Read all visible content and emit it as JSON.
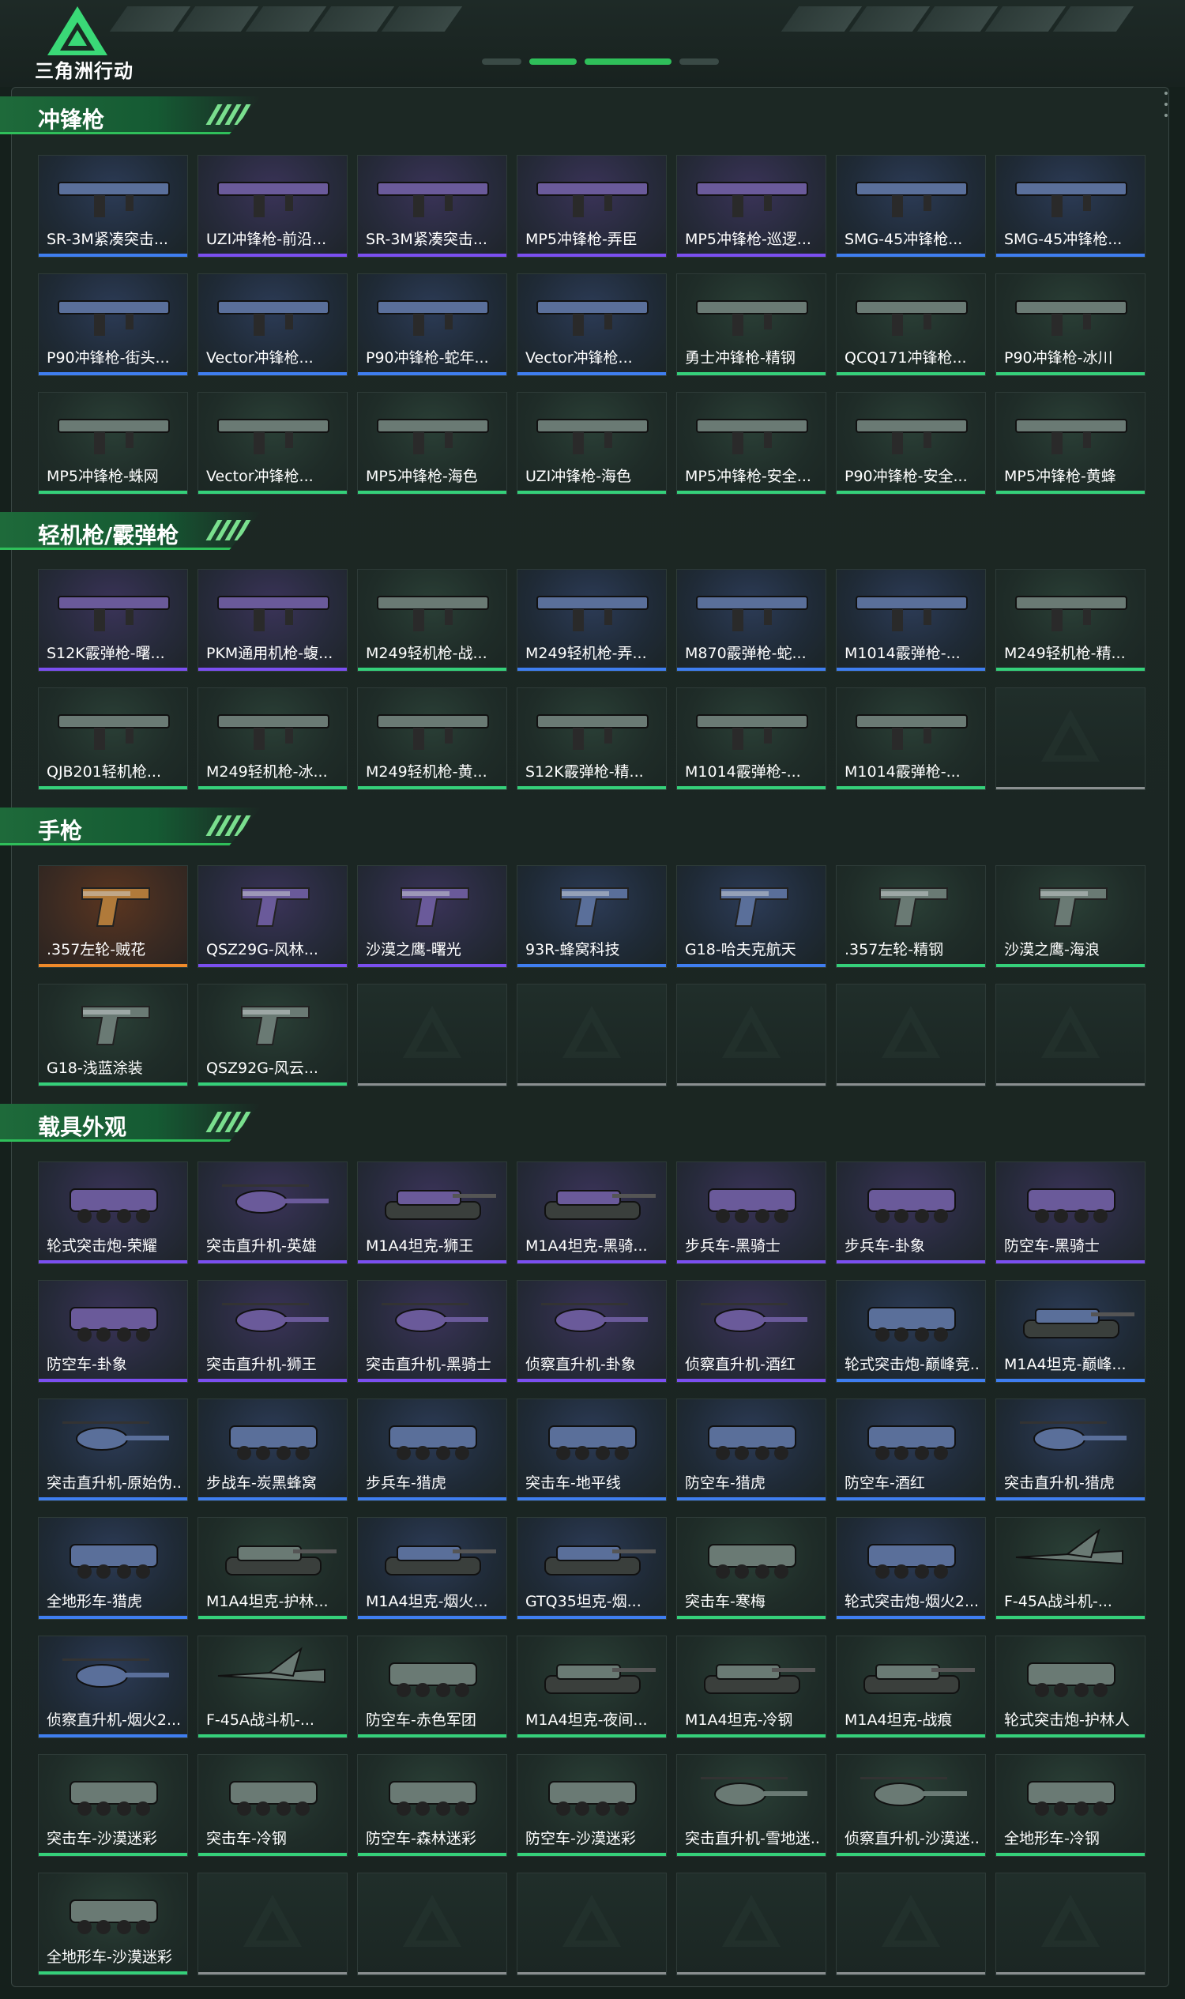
{
  "header": {
    "logo_text": "三角洲行动"
  },
  "sections": [
    {
      "title": "冲锋枪",
      "items": [
        {
          "name": "SR-3M紧凑突击...",
          "rarity": "blue",
          "kind": "gun"
        },
        {
          "name": "UZI冲锋枪-前沿...",
          "rarity": "purple",
          "kind": "gun"
        },
        {
          "name": "SR-3M紧凑突击...",
          "rarity": "purple",
          "kind": "gun"
        },
        {
          "name": "MP5冲锋枪-弄臣",
          "rarity": "purple",
          "kind": "gun"
        },
        {
          "name": "MP5冲锋枪-巡逻...",
          "rarity": "purple",
          "kind": "gun"
        },
        {
          "name": "SMG-45冲锋枪...",
          "rarity": "blue",
          "kind": "gun"
        },
        {
          "name": "SMG-45冲锋枪...",
          "rarity": "blue",
          "kind": "gun"
        },
        {
          "name": "P90冲锋枪-街头...",
          "rarity": "blue",
          "kind": "gun"
        },
        {
          "name": "Vector冲锋枪...",
          "rarity": "blue",
          "kind": "gun"
        },
        {
          "name": "P90冲锋枪-蛇年...",
          "rarity": "blue",
          "kind": "gun"
        },
        {
          "name": "Vector冲锋枪...",
          "rarity": "blue",
          "kind": "gun"
        },
        {
          "name": "勇士冲锋枪-精钢",
          "rarity": "green",
          "kind": "gun"
        },
        {
          "name": "QCQ171冲锋枪...",
          "rarity": "green",
          "kind": "gun"
        },
        {
          "name": "P90冲锋枪-冰川",
          "rarity": "green",
          "kind": "gun"
        },
        {
          "name": "MP5冲锋枪-蛛网",
          "rarity": "green",
          "kind": "gun"
        },
        {
          "name": "Vector冲锋枪...",
          "rarity": "green",
          "kind": "gun"
        },
        {
          "name": "MP5冲锋枪-海色",
          "rarity": "green",
          "kind": "gun"
        },
        {
          "name": "UZI冲锋枪-海色",
          "rarity": "green",
          "kind": "gun"
        },
        {
          "name": "MP5冲锋枪-安全...",
          "rarity": "green",
          "kind": "gun"
        },
        {
          "name": "P90冲锋枪-安全...",
          "rarity": "green",
          "kind": "gun"
        },
        {
          "name": "MP5冲锋枪-黄蜂",
          "rarity": "green",
          "kind": "gun"
        }
      ]
    },
    {
      "title": "轻机枪/霰弹枪",
      "items": [
        {
          "name": "S12K霰弹枪-曙...",
          "rarity": "purple",
          "kind": "gun"
        },
        {
          "name": "PKM通用机枪-蝮...",
          "rarity": "purple",
          "kind": "gun"
        },
        {
          "name": "M249轻机枪-战...",
          "rarity": "green",
          "kind": "gun"
        },
        {
          "name": "M249轻机枪-弄...",
          "rarity": "blue",
          "kind": "gun"
        },
        {
          "name": "M870霰弹枪-蛇...",
          "rarity": "blue",
          "kind": "gun"
        },
        {
          "name": "M1014霰弹枪-...",
          "rarity": "blue",
          "kind": "gun"
        },
        {
          "name": "M249轻机枪-精...",
          "rarity": "green",
          "kind": "gun"
        },
        {
          "name": "QJB201轻机枪...",
          "rarity": "green",
          "kind": "gun"
        },
        {
          "name": "M249轻机枪-冰...",
          "rarity": "green",
          "kind": "gun"
        },
        {
          "name": "M249轻机枪-黄...",
          "rarity": "green",
          "kind": "gun"
        },
        {
          "name": "S12K霰弹枪-精...",
          "rarity": "green",
          "kind": "gun"
        },
        {
          "name": "M1014霰弹枪-...",
          "rarity": "green",
          "kind": "gun"
        },
        {
          "name": "M1014霰弹枪-...",
          "rarity": "green",
          "kind": "gun"
        },
        {
          "name": "",
          "rarity": "empty",
          "kind": "empty"
        }
      ]
    },
    {
      "title": "手枪",
      "items": [
        {
          "name": ".357左轮-贼花",
          "rarity": "orange",
          "kind": "pistol"
        },
        {
          "name": "QSZ29G-风林...",
          "rarity": "purple",
          "kind": "pistol"
        },
        {
          "name": "沙漠之鹰-曙光",
          "rarity": "purple",
          "kind": "pistol"
        },
        {
          "name": "93R-蜂窝科技",
          "rarity": "blue",
          "kind": "pistol"
        },
        {
          "name": "G18-哈夫克航天",
          "rarity": "blue",
          "kind": "pistol"
        },
        {
          "name": ".357左轮-精钢",
          "rarity": "green",
          "kind": "pistol"
        },
        {
          "name": "沙漠之鹰-海浪",
          "rarity": "green",
          "kind": "pistol"
        },
        {
          "name": "G18-浅蓝涂装",
          "rarity": "green",
          "kind": "pistol"
        },
        {
          "name": "QSZ92G-风云...",
          "rarity": "green",
          "kind": "pistol"
        },
        {
          "name": "",
          "rarity": "empty",
          "kind": "empty"
        },
        {
          "name": "",
          "rarity": "empty",
          "kind": "empty"
        },
        {
          "name": "",
          "rarity": "empty",
          "kind": "empty"
        },
        {
          "name": "",
          "rarity": "empty",
          "kind": "empty"
        },
        {
          "name": "",
          "rarity": "empty",
          "kind": "empty"
        }
      ]
    },
    {
      "title": "载具外观",
      "items": [
        {
          "name": "轮式突击炮-荣耀",
          "rarity": "purple",
          "kind": "vehicle"
        },
        {
          "name": "突击直升机-英雄",
          "rarity": "purple",
          "kind": "heli"
        },
        {
          "name": "M1A4坦克-狮王",
          "rarity": "purple",
          "kind": "tank"
        },
        {
          "name": "M1A4坦克-黑骑...",
          "rarity": "purple",
          "kind": "tank"
        },
        {
          "name": "步兵车-黑骑士",
          "rarity": "purple",
          "kind": "vehicle"
        },
        {
          "name": "步兵车-卦象",
          "rarity": "purple",
          "kind": "vehicle"
        },
        {
          "name": "防空车-黑骑士",
          "rarity": "purple",
          "kind": "vehicle"
        },
        {
          "name": "防空车-卦象",
          "rarity": "purple",
          "kind": "vehicle"
        },
        {
          "name": "突击直升机-狮王",
          "rarity": "purple",
          "kind": "heli"
        },
        {
          "name": "突击直升机-黑骑士",
          "rarity": "purple",
          "kind": "heli"
        },
        {
          "name": "侦察直升机-卦象",
          "rarity": "purple",
          "kind": "heli"
        },
        {
          "name": "侦察直升机-酒红",
          "rarity": "purple",
          "kind": "heli"
        },
        {
          "name": "轮式突击炮-巅峰竞...",
          "rarity": "blue",
          "kind": "vehicle"
        },
        {
          "name": "M1A4坦克-巅峰...",
          "rarity": "blue",
          "kind": "tank"
        },
        {
          "name": "突击直升机-原始伪...",
          "rarity": "blue",
          "kind": "heli"
        },
        {
          "name": "步战车-炭黑蜂窝",
          "rarity": "blue",
          "kind": "vehicle"
        },
        {
          "name": "步兵车-猎虎",
          "rarity": "blue",
          "kind": "vehicle"
        },
        {
          "name": "突击车-地平线",
          "rarity": "blue",
          "kind": "vehicle"
        },
        {
          "name": "防空车-猎虎",
          "rarity": "blue",
          "kind": "vehicle"
        },
        {
          "name": "防空车-酒红",
          "rarity": "blue",
          "kind": "vehicle"
        },
        {
          "name": "突击直升机-猎虎",
          "rarity": "blue",
          "kind": "heli"
        },
        {
          "name": "全地形车-猎虎",
          "rarity": "blue",
          "kind": "vehicle"
        },
        {
          "name": "M1A4坦克-护林...",
          "rarity": "green",
          "kind": "tank"
        },
        {
          "name": "M1A4坦克-烟火...",
          "rarity": "blue",
          "kind": "tank"
        },
        {
          "name": "GTQ35坦克-烟...",
          "rarity": "blue",
          "kind": "tank"
        },
        {
          "name": "突击车-寒梅",
          "rarity": "green",
          "kind": "vehicle"
        },
        {
          "name": "轮式突击炮-烟火2...",
          "rarity": "blue",
          "kind": "vehicle"
        },
        {
          "name": "F-45A战斗机-...",
          "rarity": "green",
          "kind": "jet"
        },
        {
          "name": "侦察直升机-烟火2...",
          "rarity": "blue",
          "kind": "heli"
        },
        {
          "name": "F-45A战斗机-...",
          "rarity": "green",
          "kind": "jet"
        },
        {
          "name": "防空车-赤色军团",
          "rarity": "green",
          "kind": "vehicle"
        },
        {
          "name": "M1A4坦克-夜间...",
          "rarity": "green",
          "kind": "tank"
        },
        {
          "name": "M1A4坦克-冷钢",
          "rarity": "green",
          "kind": "tank"
        },
        {
          "name": "M1A4坦克-战痕",
          "rarity": "green",
          "kind": "tank"
        },
        {
          "name": "轮式突击炮-护林人",
          "rarity": "green",
          "kind": "vehicle"
        },
        {
          "name": "突击车-沙漠迷彩",
          "rarity": "green",
          "kind": "vehicle"
        },
        {
          "name": "突击车-冷钢",
          "rarity": "green",
          "kind": "vehicle"
        },
        {
          "name": "防空车-森林迷彩",
          "rarity": "green",
          "kind": "vehicle"
        },
        {
          "name": "防空车-沙漠迷彩",
          "rarity": "green",
          "kind": "vehicle"
        },
        {
          "name": "突击直升机-雪地迷...",
          "rarity": "green",
          "kind": "heli"
        },
        {
          "name": "侦察直升机-沙漠迷...",
          "rarity": "green",
          "kind": "heli"
        },
        {
          "name": "全地形车-冷钢",
          "rarity": "green",
          "kind": "vehicle"
        },
        {
          "name": "全地形车-沙漠迷彩",
          "rarity": "green",
          "kind": "vehicle"
        },
        {
          "name": "",
          "rarity": "empty",
          "kind": "empty"
        },
        {
          "name": "",
          "rarity": "empty",
          "kind": "empty"
        },
        {
          "name": "",
          "rarity": "empty",
          "kind": "empty"
        },
        {
          "name": "",
          "rarity": "empty",
          "kind": "empty"
        },
        {
          "name": "",
          "rarity": "empty",
          "kind": "empty"
        },
        {
          "name": "",
          "rarity": "empty",
          "kind": "empty"
        }
      ]
    }
  ],
  "colors": {
    "accent": "#2fbf5a",
    "rarity_purple": "#7b4ff0",
    "rarity_blue": "#3f7ef0",
    "rarity_green": "#35d07a",
    "rarity_orange": "#f08a2a"
  }
}
